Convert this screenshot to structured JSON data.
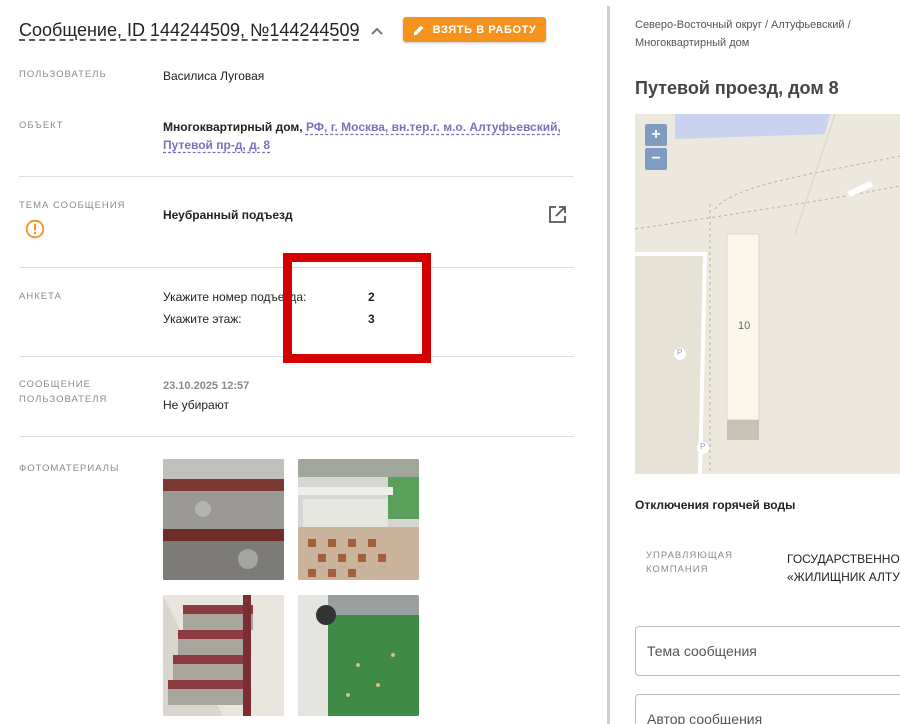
{
  "header": {
    "title": "Сообщение, ID 144244509, №144244509",
    "take_button": "ВЗЯТЬ В РАБОТУ"
  },
  "details": {
    "user_label": "ПОЛЬЗОВАТЕЛЬ",
    "user_value": "Василиса Луговая",
    "object_label": "ОБЪЕКТ",
    "object_type": "Многоквартирный дом,",
    "object_address_line1": "РФ, г. Москва, вн.тер.г. м.о. Алтуфьевский,",
    "object_address_line2": "Путевой пр-д, д. 8",
    "topic_label": "ТЕМА СООБЩЕНИЯ",
    "topic_value": "Неубранный подъезд",
    "survey_label": "АНКЕТА",
    "survey": [
      {
        "question": "Укажите номер подъезда:",
        "answer": "2"
      },
      {
        "question": "Укажите этаж:",
        "answer": "3"
      }
    ],
    "message_label_line1": "СООБЩЕНИЕ",
    "message_label_line2": "ПОЛЬЗОВАТЕЛЯ",
    "message_date": "23.10.2025 12:57",
    "message_text": "Не убирают",
    "photos_label": "ФОТОМАТЕРИАЛЫ"
  },
  "side": {
    "breadcrumb_line1": "Северо-Восточный округ / Алтуфьевский /",
    "breadcrumb_line2": "Многоквартирный дом",
    "address": "Путевой проезд, дом 8",
    "map_building_number": "10",
    "map_parking_1": "P",
    "map_parking_2": "P",
    "zoom_in": "+",
    "zoom_out": "−",
    "hot_water": "Отключения горячей воды",
    "uk_label_line1": "УПРАВЛЯЮЩАЯ",
    "uk_label_line2": "КОМПАНИЯ",
    "uk_value_line1": "ГОСУДАРСТВЕННОЕ",
    "uk_value_line2": "«ЖИЛИЩНИК АЛТУ",
    "topic_field_placeholder": "Тема сообщения",
    "author_field_placeholder": "Автор сообщения"
  },
  "colors": {
    "accent": "#f6921e",
    "link": "#7e6fbd",
    "highlight": "#d40000"
  }
}
